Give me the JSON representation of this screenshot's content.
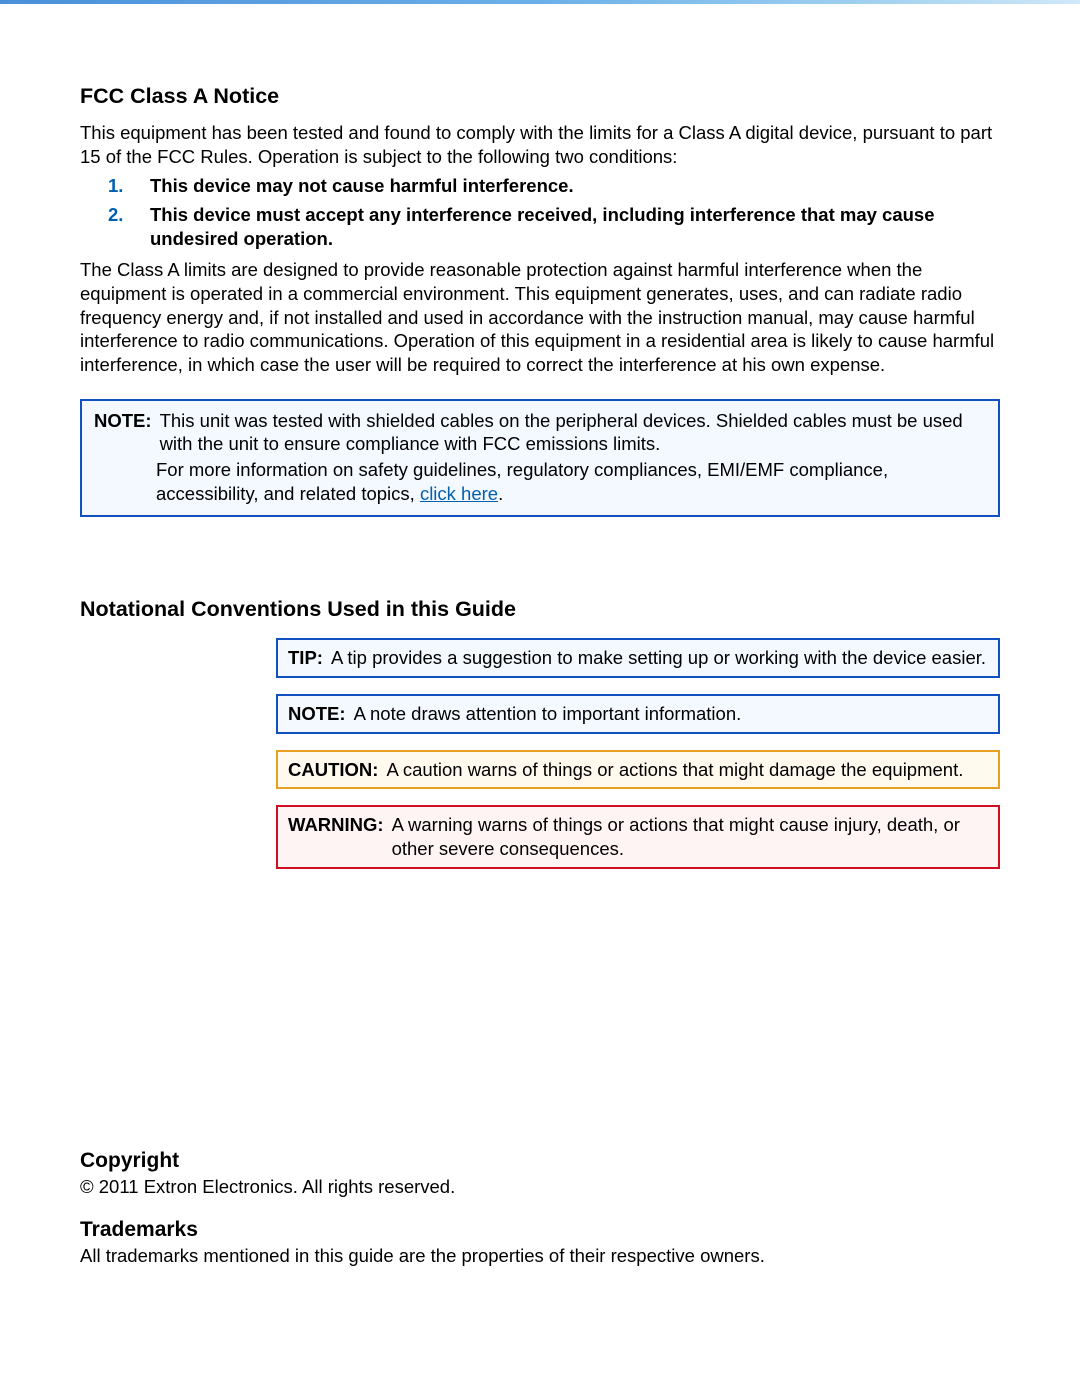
{
  "fcc": {
    "heading": "FCC Class A Notice",
    "intro": "This equipment has been tested and found to comply with the limits for a Class A digital device, pursuant to part 15 of the FCC Rules. Operation is subject to the following two conditions:",
    "conditions": [
      "This device may not cause harmful interference.",
      "This device must accept any interference received, including interference that may cause undesired operation."
    ],
    "body": "The Class A limits are designed to provide reasonable protection against harmful interference when the equipment is operated in a commercial environment. This equipment generates, uses, and can radiate radio frequency energy and, if not installed and used in accordance with the instruction manual, may cause harmful interference to radio communications. Operation of this equipment in a residential area is likely to cause harmful interference, in which case the user will be required to correct the interference at his own expense."
  },
  "note_box": {
    "label": "NOTE:",
    "line1": "This unit was tested with shielded cables on the peripheral devices. Shielded cables must be used with the unit to ensure compliance with FCC emissions limits.",
    "line2_pre": "For more information on safety guidelines, regulatory compliances, EMI/EMF compliance, accessibility, and related topics, ",
    "link_text": "click here",
    "line2_post": "."
  },
  "conventions": {
    "heading": "Notational Conventions Used in this Guide",
    "tip": {
      "label": "TIP:",
      "text": "A tip provides a suggestion to make setting up or working with the device easier."
    },
    "note": {
      "label": "NOTE:",
      "text": "A note draws attention to important information."
    },
    "caution": {
      "label": "CAUTION:",
      "text": "A caution warns of things or actions that might damage the equipment."
    },
    "warning": {
      "label": "WARNING:",
      "text": "A warning warns of things or actions that might cause injury, death, or other severe consequences."
    }
  },
  "copyright": {
    "heading": "Copyright",
    "text": "© 2011  Extron Electronics.  All rights reserved."
  },
  "trademarks": {
    "heading": "Trademarks",
    "text": "All trademarks mentioned in this guide are the properties of their respective owners."
  }
}
